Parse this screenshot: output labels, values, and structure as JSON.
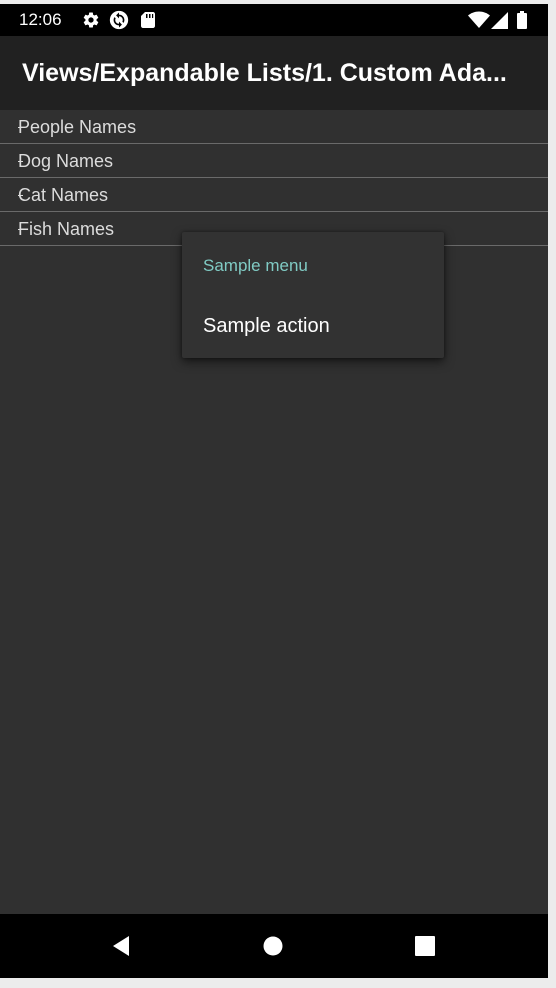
{
  "status_bar": {
    "time": "12:06",
    "left_icons": [
      "gear-icon",
      "sync-icon",
      "sd-card-icon"
    ],
    "right_icons": [
      "wifi-icon",
      "cell-signal-icon",
      "battery-icon"
    ]
  },
  "app_bar": {
    "title": "Views/Expandable Lists/1. Custom Ada..."
  },
  "list": {
    "items": [
      {
        "label": "People Names"
      },
      {
        "label": "Dog Names"
      },
      {
        "label": "Cat Names"
      },
      {
        "label": "Fish Names"
      }
    ]
  },
  "context_menu": {
    "title": "Sample menu",
    "actions": [
      {
        "label": "Sample action"
      }
    ],
    "title_color": "#80cbc4"
  },
  "nav_bar": {
    "buttons": [
      "back-icon",
      "home-icon",
      "recents-icon"
    ]
  },
  "colors": {
    "background": "#303030",
    "app_bar": "#212121",
    "status_bar": "#000000",
    "accent": "#80cbc4"
  }
}
